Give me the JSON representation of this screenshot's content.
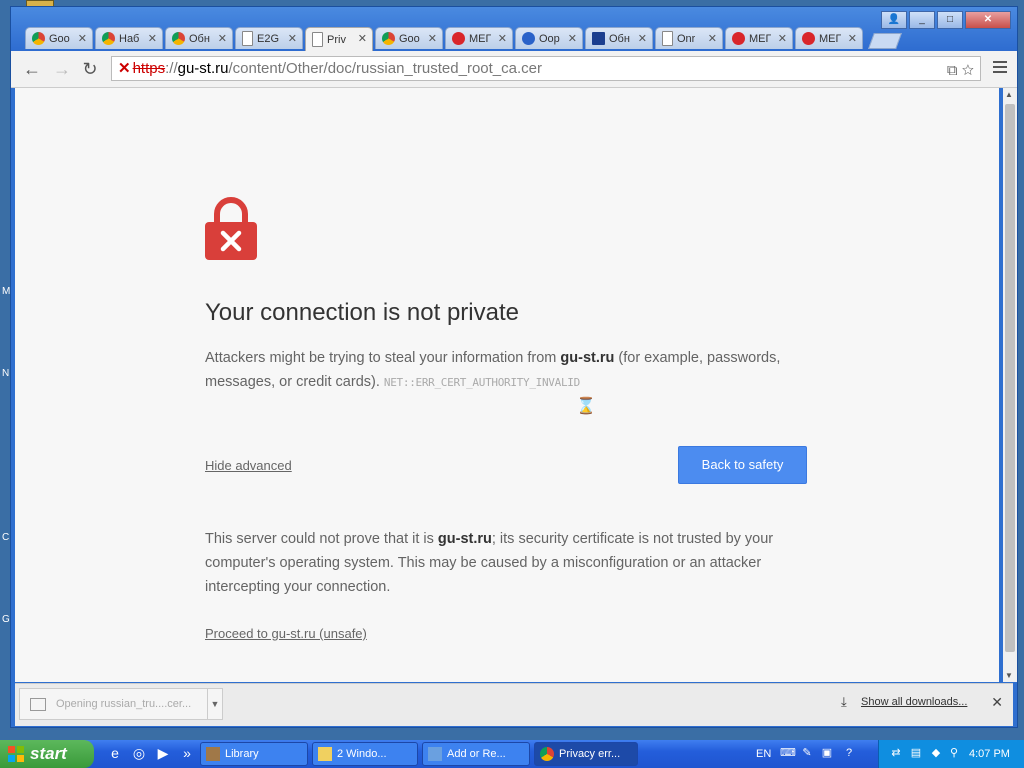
{
  "tabs": [
    {
      "title": "Goo",
      "fav": "chrome"
    },
    {
      "title": "Наб",
      "fav": "chrome"
    },
    {
      "title": "Обн",
      "fav": "chrome"
    },
    {
      "title": "E2G",
      "fav": "page"
    },
    {
      "title": "Priv",
      "fav": "page",
      "active": true
    },
    {
      "title": "Goo",
      "fav": "chrome"
    },
    {
      "title": "МЕГ",
      "fav": "mega"
    },
    {
      "title": "Оор",
      "fav": "edge"
    },
    {
      "title": "Обн",
      "fav": "ru"
    },
    {
      "title": "Onr",
      "fav": "page"
    },
    {
      "title": "МЕГ",
      "fav": "mega"
    },
    {
      "title": "МЕГ",
      "fav": "mega"
    }
  ],
  "url": {
    "lock_mark": "✕",
    "scheme": "https",
    "sep": "://",
    "host": "gu-st.ru",
    "path": "/content/Other/doc/russian_trusted_root_ca.cer"
  },
  "page": {
    "heading": "Your connection is not private",
    "p1_before": "Attackers might be trying to steal your information from ",
    "p1_host": "gu-st.ru",
    "p1_after": " (for example, passwords, messages, or credit cards). ",
    "error_code": "NET::ERR_CERT_AUTHORITY_INVALID",
    "hide_advanced": "Hide advanced",
    "back_button": "Back to safety",
    "p2_before": "This server could not prove that it is ",
    "p2_host": "gu-st.ru",
    "p2_after": "; its security certificate is not trusted by your computer's operating system. This may be caused by a misconfiguration or an attacker intercepting your connection.",
    "proceed_link": "Proceed to gu-st.ru (unsafe)"
  },
  "downloads": {
    "item": "Opening russian_tru....cer...",
    "show_all": "Show all downloads...",
    "close": "✕"
  },
  "taskbar": {
    "start": "start",
    "tasks": [
      "Library",
      "2 Windo...",
      "Add or Re...",
      "Privacy err..."
    ],
    "lang": "EN",
    "clock": "4:07 PM"
  },
  "desktop_letters": [
    "M",
    "N",
    "C",
    "G"
  ],
  "colors": {
    "accent": "#4c8cf0",
    "danger": "#d93f3a"
  }
}
